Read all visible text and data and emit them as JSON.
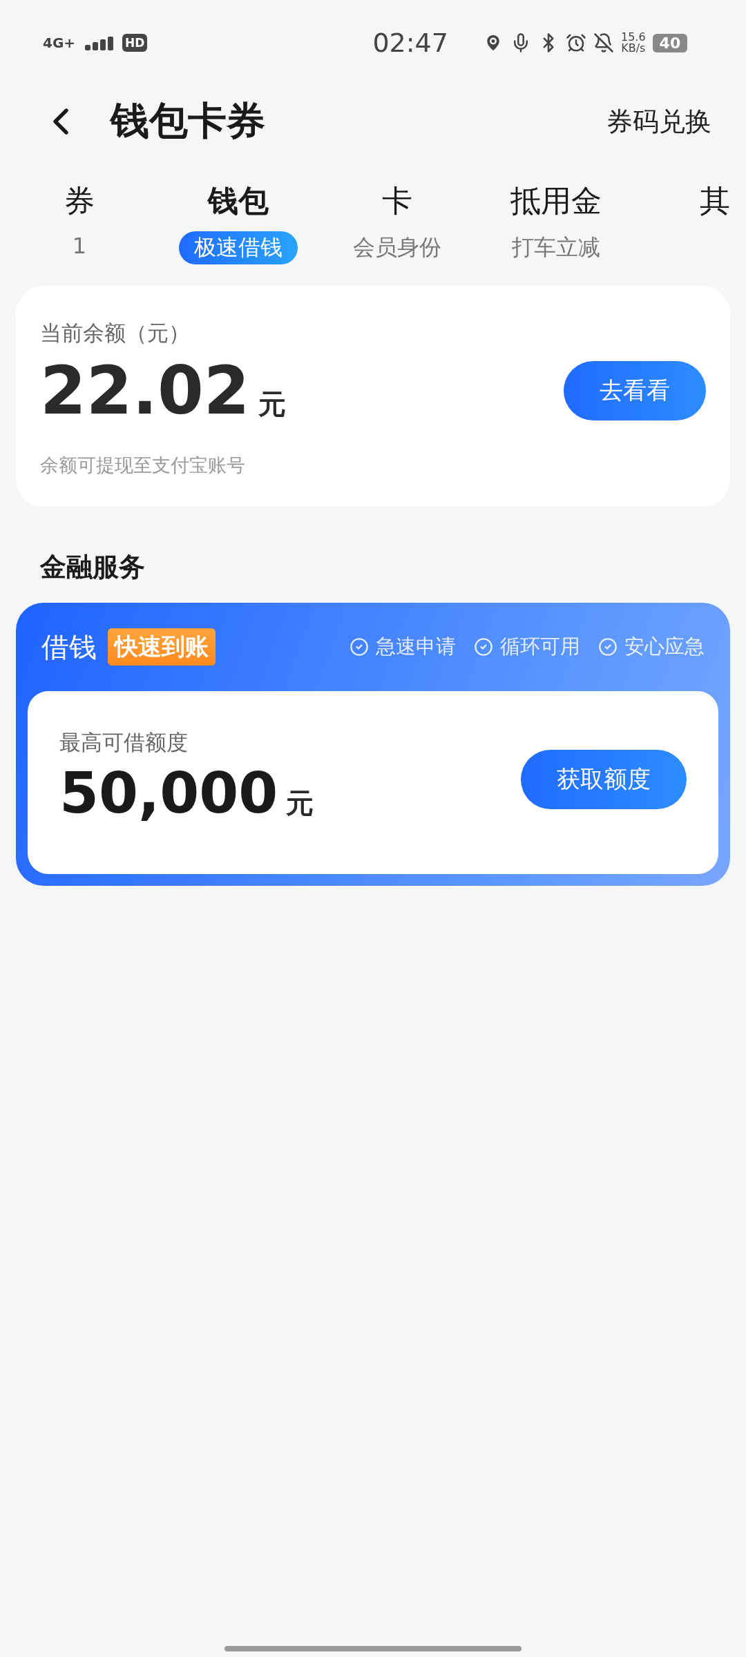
{
  "status_bar": {
    "network": "4G+",
    "hd_badge": "HD",
    "time": "02:47",
    "speed_value": "15.6",
    "speed_unit": "KB/s",
    "battery": "40"
  },
  "header": {
    "title": "钱包卡券",
    "action": "券码兑换"
  },
  "tabs": [
    {
      "label": "券",
      "sub": "1",
      "selected": false
    },
    {
      "label": "钱包",
      "sub": "极速借钱",
      "selected": true
    },
    {
      "label": "卡",
      "sub": "会员身份",
      "selected": false
    },
    {
      "label": "抵用金",
      "sub": "打车立减",
      "selected": false
    },
    {
      "label": "其",
      "selected": false
    }
  ],
  "balance_card": {
    "label": "当前余额（元）",
    "amount": "22.02",
    "unit": "元",
    "button": "去看看",
    "note": "余额可提现至支付宝账号"
  },
  "finance_section": {
    "title": "金融服务",
    "loan_card": {
      "title": "借钱",
      "badge": "快速到账",
      "features": [
        "急速申请",
        "循环可用",
        "安心应急"
      ],
      "limit_label": "最高可借额度",
      "amount": "50,000",
      "unit": "元",
      "button": "获取额度"
    }
  }
}
